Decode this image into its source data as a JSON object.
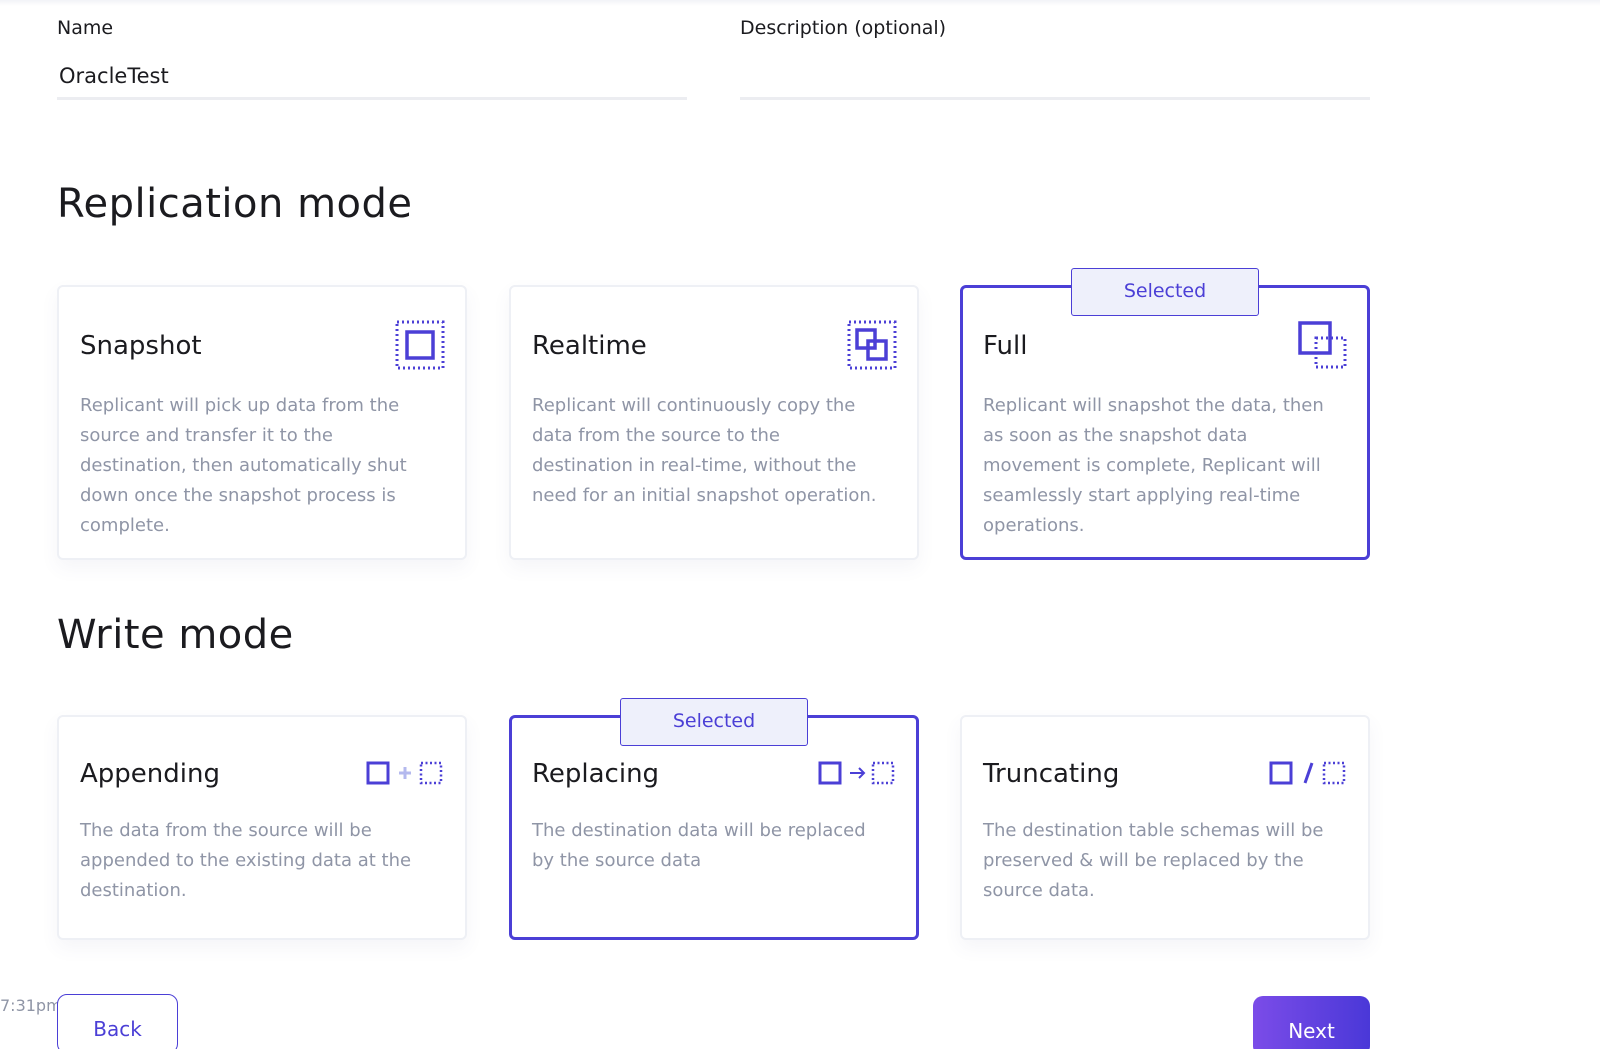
{
  "form": {
    "name_label": "Name",
    "name_value": "OracleTest",
    "description_label": "Description (optional)",
    "description_value": "",
    "description_placeholder": ""
  },
  "replication_mode": {
    "title": "Replication mode",
    "selected_label": "Selected",
    "selected_option": "Full",
    "options": [
      {
        "title": "Snapshot",
        "icon": "snapshot-icon",
        "description": "Replicant will pick up data from the source and transfer it to the destination, then automatically shut down once the snapshot process is complete.",
        "selected": false
      },
      {
        "title": "Realtime",
        "icon": "realtime-icon",
        "description": "Replicant will continuously copy the data from the source to the destination in real-time, without the need for an initial snapshot operation.",
        "selected": false
      },
      {
        "title": "Full",
        "icon": "full-icon",
        "description": "Replicant will snapshot the data, then as soon as the snapshot data movement is complete, Replicant will seamlessly start applying real-time operations.",
        "selected": true
      }
    ]
  },
  "write_mode": {
    "title": "Write mode",
    "selected_label": "Selected",
    "selected_option": "Replacing",
    "options": [
      {
        "title": "Appending",
        "icon": "append-icon",
        "description": "The data from the source will be appended to the existing data at the destination.",
        "selected": false
      },
      {
        "title": "Replacing",
        "icon": "replace-icon",
        "description": "The destination data will be replaced by the source data",
        "selected": true
      },
      {
        "title": "Truncating",
        "icon": "truncate-icon",
        "description": "The destination table schemas will be preserved & will be replaced by the source data.",
        "selected": false
      }
    ]
  },
  "footer": {
    "timestamp": "7:31pm",
    "back_label": "Back",
    "next_label": "Next"
  },
  "colors": {
    "accent": "#4b3fd6",
    "badge_background": "#eef0fb",
    "description_text": "#8f95a6",
    "next_gradient_start": "#7b4ce8",
    "next_gradient_end": "#4a38d8"
  }
}
